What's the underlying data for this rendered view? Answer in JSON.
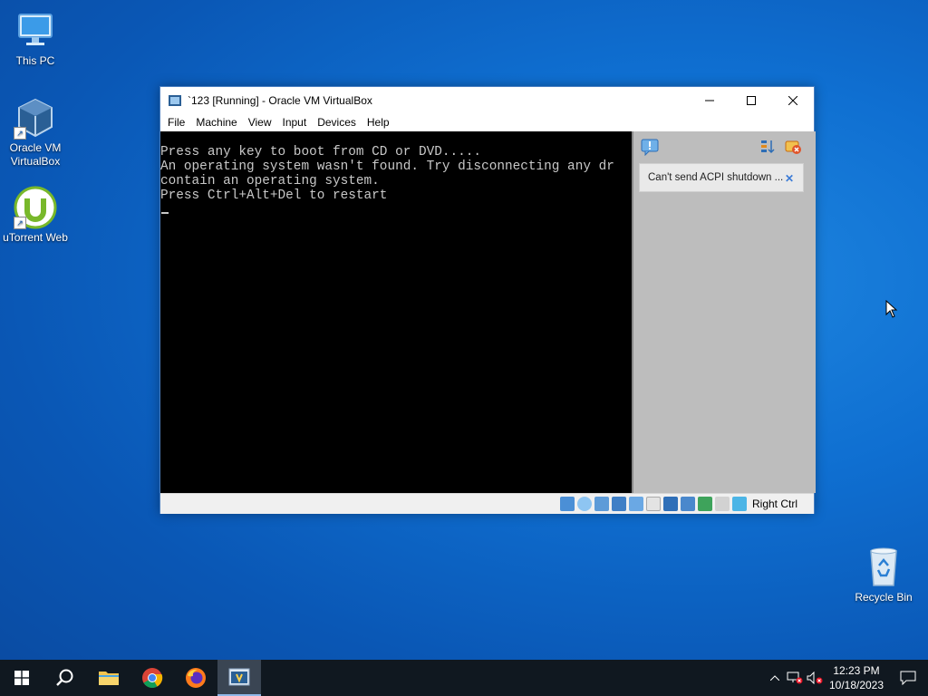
{
  "desktop": {
    "icons": [
      {
        "label": "This PC"
      },
      {
        "label": "Oracle VM VirtualBox"
      },
      {
        "label": "uTorrent Web"
      },
      {
        "label": "Recycle Bin"
      }
    ]
  },
  "window": {
    "title": "`123 [Running] - Oracle VM VirtualBox",
    "menu": [
      "File",
      "Machine",
      "View",
      "Input",
      "Devices",
      "Help"
    ],
    "console_lines": [
      "Press any key to boot from CD or DVD.....",
      "An operating system wasn't found. Try disconnecting any dr",
      "contain an operating system.",
      "Press Ctrl+Alt+Del to restart"
    ],
    "notification": "Can't send ACPI shutdown ...",
    "host_key": "Right Ctrl"
  },
  "taskbar": {
    "time": "12:23 PM",
    "date": "10/18/2023"
  }
}
